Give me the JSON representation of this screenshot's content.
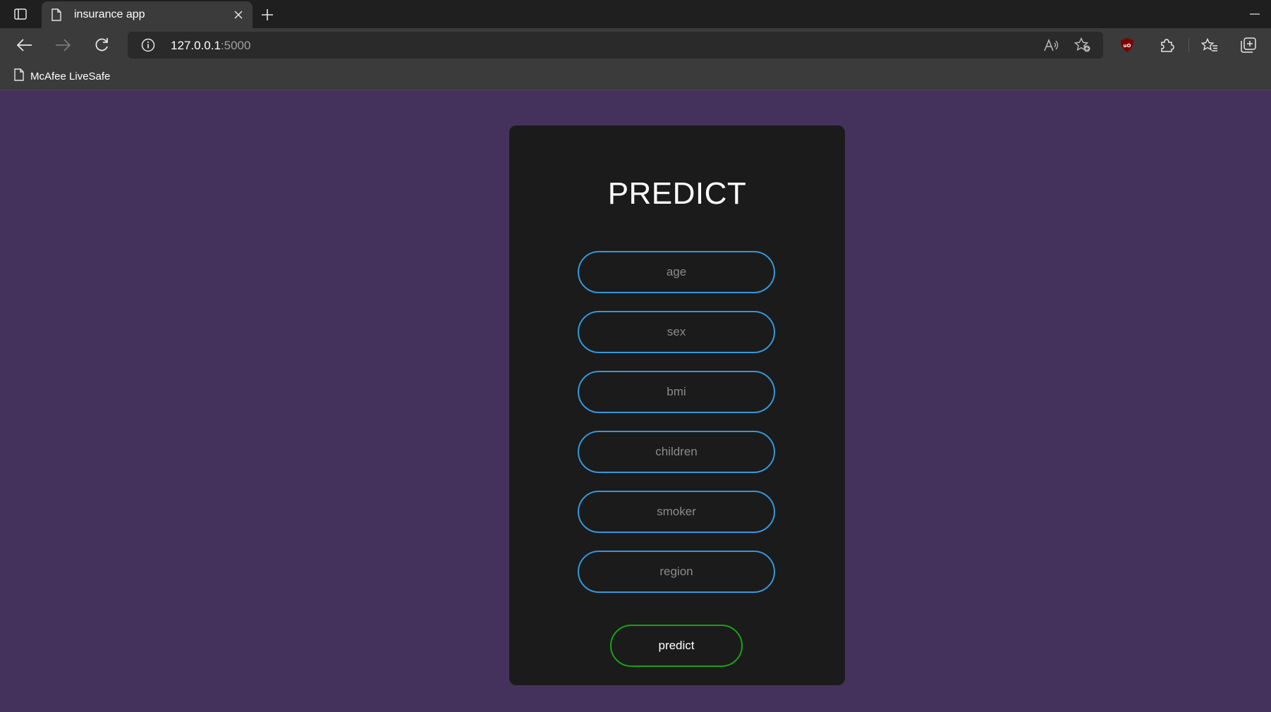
{
  "browser": {
    "tab_title": "insurance app",
    "url_host": "127.0.0.1",
    "url_port": ":5000",
    "bookmark_label": "McAfee LiveSafe"
  },
  "page": {
    "heading": "PREDICT",
    "fields": [
      {
        "name": "age",
        "placeholder": "age"
      },
      {
        "name": "sex",
        "placeholder": "sex"
      },
      {
        "name": "bmi",
        "placeholder": "bmi"
      },
      {
        "name": "children",
        "placeholder": "children"
      },
      {
        "name": "smoker",
        "placeholder": "smoker"
      },
      {
        "name": "region",
        "placeholder": "region"
      }
    ],
    "submit_label": "predict"
  },
  "colors": {
    "page_background": "#44325c",
    "card_background": "#1b1b1b",
    "field_border": "#3498db",
    "button_border": "#16a314"
  },
  "icons": {
    "tab_actions": "tab-actions-icon",
    "tab_page": "page-icon",
    "tab_close": "close-icon",
    "new_tab": "plus-icon",
    "minimize": "minimize-icon",
    "back": "back-arrow-icon",
    "forward": "forward-arrow-icon",
    "refresh": "refresh-icon",
    "site_info": "info-icon",
    "read_aloud": "read-aloud-icon",
    "add_favorite": "add-favorite-icon",
    "ublock": "ublock-origin-icon",
    "extensions": "puzzle-icon",
    "favorites": "favorites-icon",
    "collections": "collections-icon",
    "bookmark_page": "page-icon"
  }
}
